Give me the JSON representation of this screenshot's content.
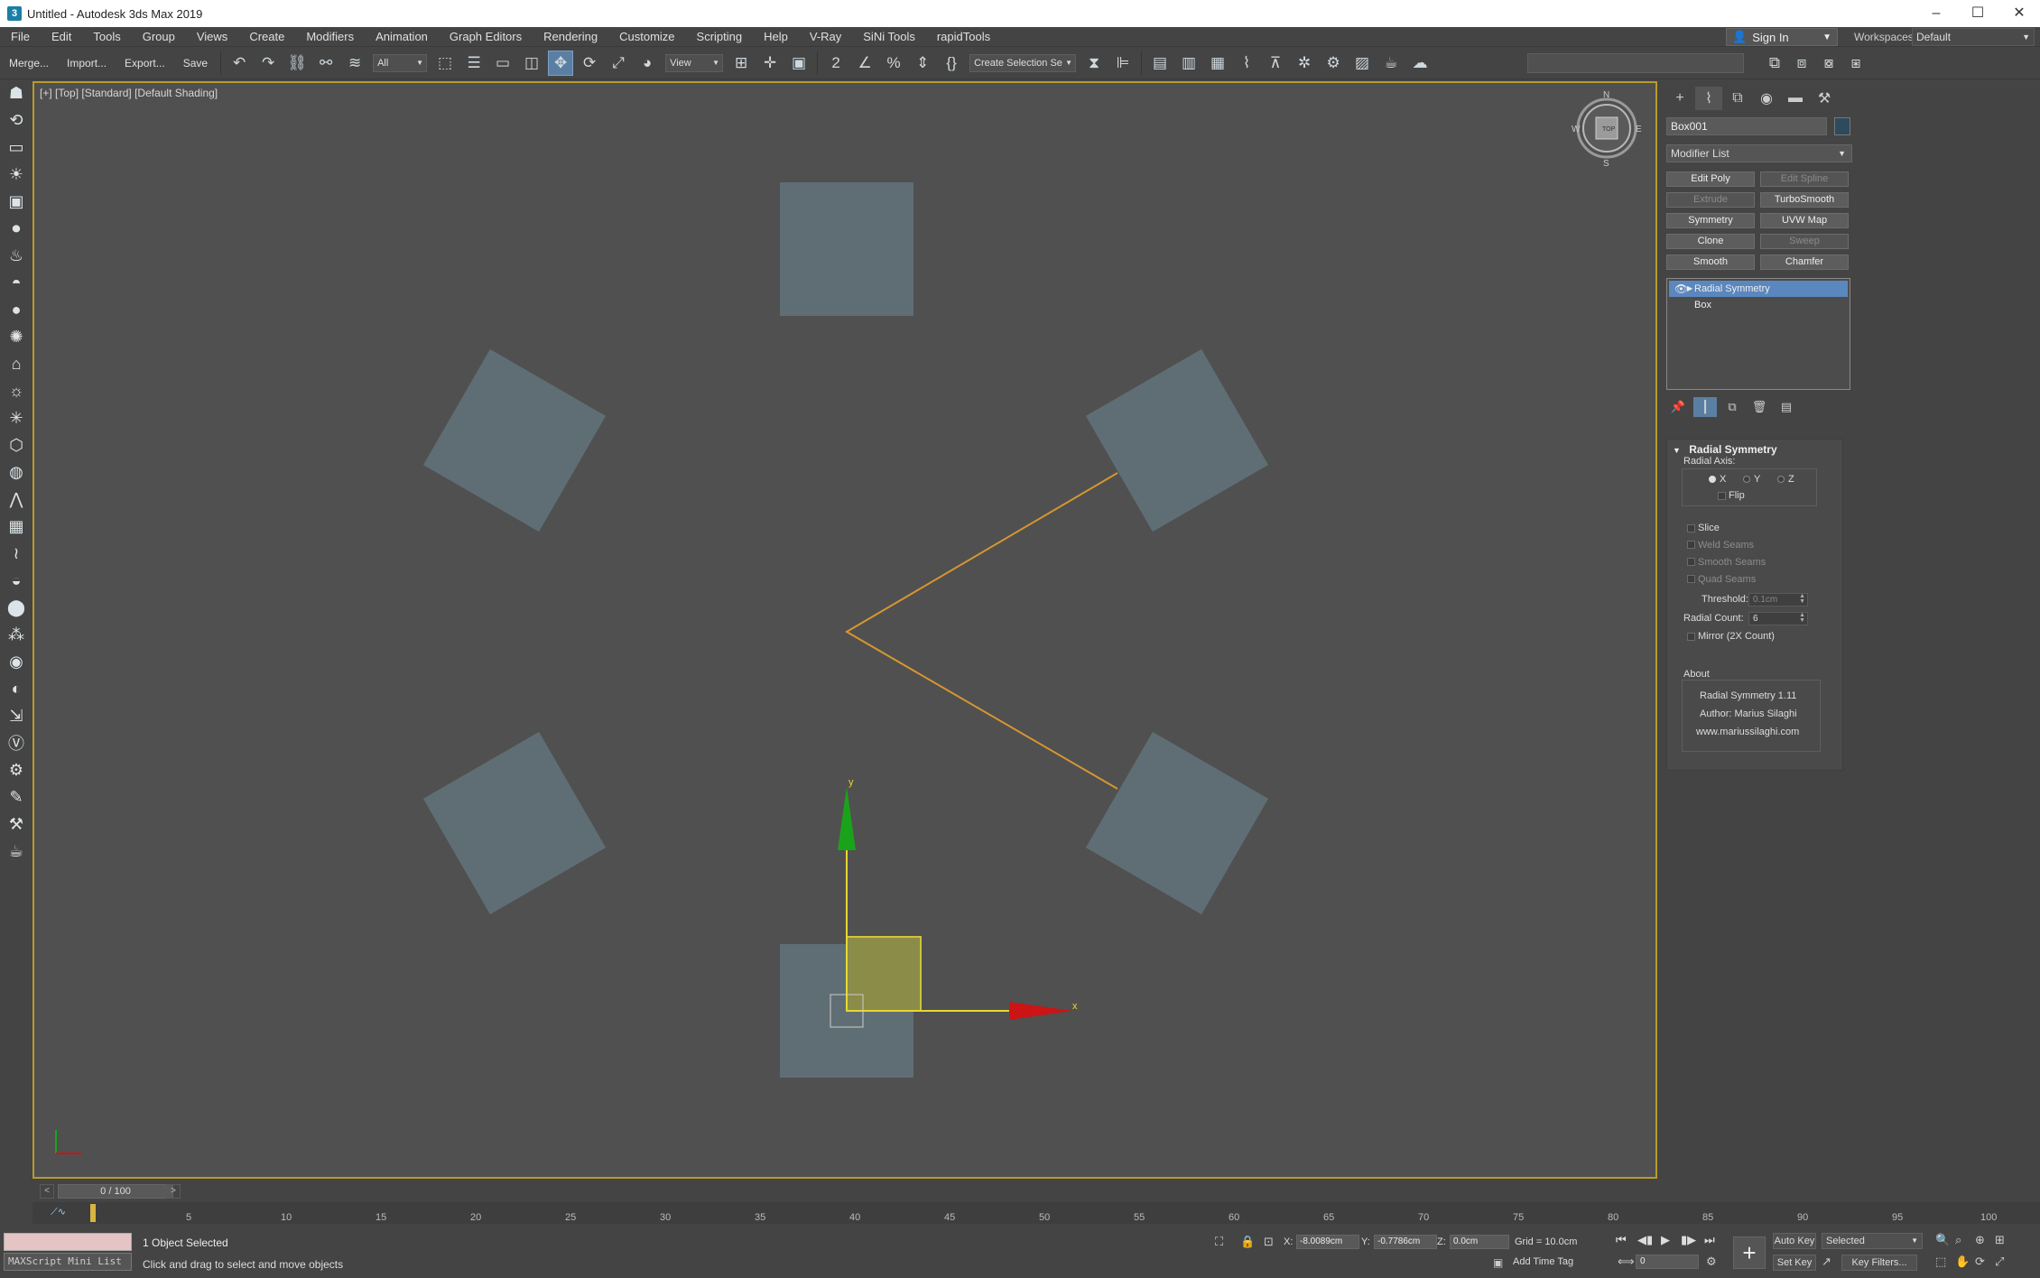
{
  "window": {
    "title": "Untitled - Autodesk 3ds Max 2019",
    "min": "–",
    "max": "☐",
    "close": "✕"
  },
  "menu": [
    "File",
    "Edit",
    "Tools",
    "Group",
    "Views",
    "Create",
    "Modifiers",
    "Animation",
    "Graph Editors",
    "Rendering",
    "Customize",
    "Scripting",
    "Help",
    "V-Ray",
    "SiNi Tools",
    "rapidTools"
  ],
  "account": {
    "signin": "Sign In",
    "workspaces_label": "Workspaces:",
    "workspace": "Default"
  },
  "toolbar": {
    "merge": "Merge...",
    "import": "Import...",
    "export": "Export...",
    "save": "Save",
    "filter": "All",
    "ref_coord": "View",
    "selection_set": "Create Selection Se"
  },
  "viewport": {
    "label": "[+] [Top] [Standard] [Default Shading]",
    "compass": {
      "n": "N",
      "s": "S",
      "w": "W",
      "e": "E",
      "top": "TOP"
    },
    "gizmo_x": "x",
    "gizmo_y": "y"
  },
  "panel": {
    "object_name": "Box001",
    "object_color": "#2d4b5c",
    "modifier_list": "Modifier List",
    "modifier_buttons": [
      {
        "label": "Edit Poly",
        "enabled": true
      },
      {
        "label": "Edit Spline",
        "enabled": false
      },
      {
        "label": "Extrude",
        "enabled": false
      },
      {
        "label": "TurboSmooth",
        "enabled": true
      },
      {
        "label": "Symmetry",
        "enabled": true
      },
      {
        "label": "UVW Map",
        "enabled": true
      },
      {
        "label": "Clone",
        "enabled": true
      },
      {
        "label": "Sweep",
        "enabled": false
      },
      {
        "label": "Smooth",
        "enabled": true
      },
      {
        "label": "Chamfer",
        "enabled": true
      }
    ],
    "stack": [
      "Radial Symmetry",
      "Box"
    ]
  },
  "rollout": {
    "title": "Radial Symmetry",
    "radial_axis": "Radial Axis:",
    "axis_x": "X",
    "axis_y": "Y",
    "axis_z": "Z",
    "flip": "Flip",
    "slice": "Slice",
    "weld_seams": "Weld Seams",
    "smooth_seams": "Smooth Seams",
    "quad_seams": "Quad Seams",
    "threshold_label": "Threshold:",
    "threshold_value": "0.1cm",
    "radial_count_label": "Radial Count:",
    "radial_count_value": "6",
    "mirror": "Mirror (2X Count)",
    "about_label": "About",
    "about_name": "Radial Symmetry 1.11",
    "about_author": "Author: Marius Silaghi",
    "about_url": "www.mariussilaghi.com"
  },
  "timeline": {
    "frame": "0 / 100",
    "prev": "<",
    "next": ">",
    "ticks": [
      "5",
      "10",
      "15",
      "20",
      "25",
      "30",
      "35",
      "40",
      "45",
      "50",
      "55",
      "60",
      "65",
      "70",
      "75",
      "80",
      "85",
      "90",
      "95",
      "100"
    ]
  },
  "status": {
    "maxscript": "MAXScript Mini List",
    "selected": "1 Object Selected",
    "prompt": "Click and drag to select and move objects",
    "x_label": "X:",
    "x_value": "-8.0089cm",
    "y_label": "Y:",
    "y_value": "-0.7786cm",
    "z_label": "Z:",
    "z_value": "0.0cm",
    "grid": "Grid = 10.0cm",
    "add_time_tag": "Add Time Tag",
    "auto_key": "Auto Key",
    "set_key": "Set Key",
    "key_mode": "Selected",
    "key_filters": "Key Filters...",
    "current_frame": "0"
  },
  "colors": {
    "viewport_bg": "#505050",
    "box": "#5f6e74",
    "selection": "#8a8c48",
    "spline": "#d6962f",
    "axis_x": "#cc1414",
    "axis_y": "#1aa31a",
    "stack_selected": "#5b87bf"
  }
}
